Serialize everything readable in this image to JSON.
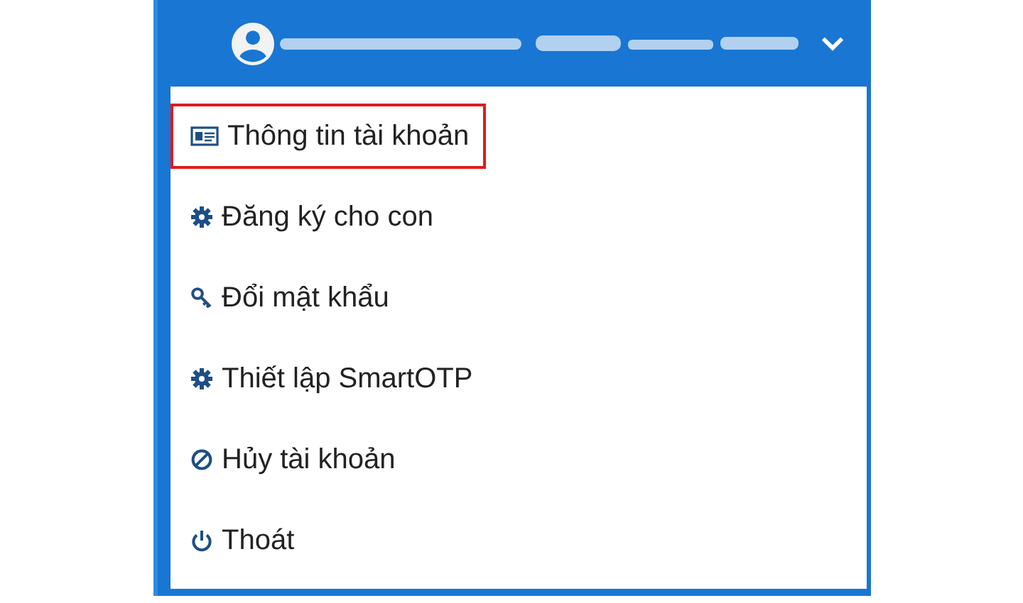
{
  "header": {
    "user_menu_expanded": true
  },
  "menu": {
    "items": [
      {
        "label": "Thông tin tài khoản",
        "kind": "id-card",
        "highlighted": true
      },
      {
        "label": "Đăng ký cho con",
        "kind": "gear",
        "highlighted": false
      },
      {
        "label": "Đổi mật khẩu",
        "kind": "key",
        "highlighted": false
      },
      {
        "label": "Thiết lập SmartOTP",
        "kind": "gear",
        "highlighted": false
      },
      {
        "label": "Hủy tài khoản",
        "kind": "ban",
        "highlighted": false
      },
      {
        "label": "Thoát",
        "kind": "power",
        "highlighted": false
      }
    ]
  }
}
